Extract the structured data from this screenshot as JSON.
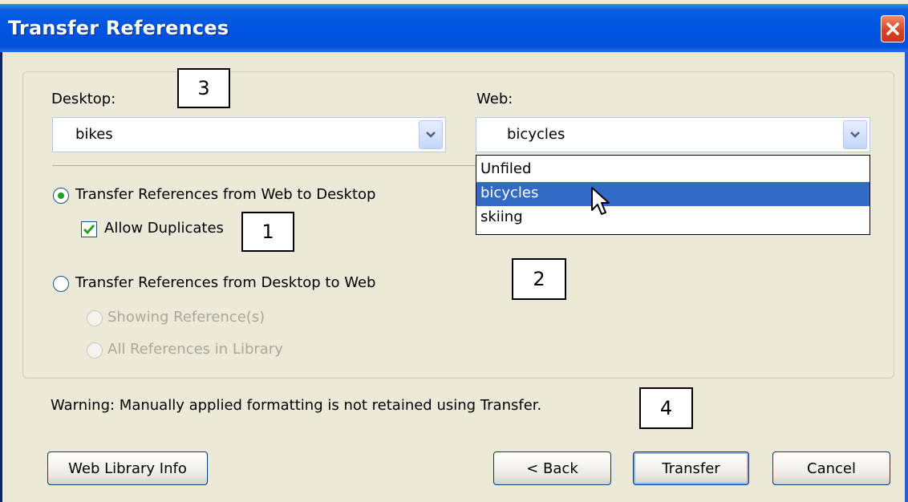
{
  "dialog": {
    "title": "Transfer References"
  },
  "desktop": {
    "label": "Desktop:",
    "selected": "bikes"
  },
  "web": {
    "label": "Web:",
    "selected": "bicycles",
    "options": [
      "Unfiled",
      "bicycles",
      "skiing"
    ],
    "highlighted_index": 1
  },
  "options": {
    "web_to_desktop": "Transfer References from Web to Desktop",
    "allow_duplicates": "Allow Duplicates",
    "desktop_to_web": "Transfer References from Desktop to Web",
    "showing_refs": "Showing Reference(s)",
    "all_refs": "All References in Library"
  },
  "warning": "Warning: Manually applied formatting is not retained using Transfer.",
  "buttons": {
    "web_library_info": "Web Library Info",
    "back": "< Back",
    "transfer": "Transfer",
    "cancel": "Cancel"
  },
  "annotations": [
    "1",
    "2",
    "3",
    "4"
  ],
  "colors": {
    "titlebar": "#0054e3",
    "highlight": "#316ac5",
    "dialog_bg": "#ece9d8"
  }
}
